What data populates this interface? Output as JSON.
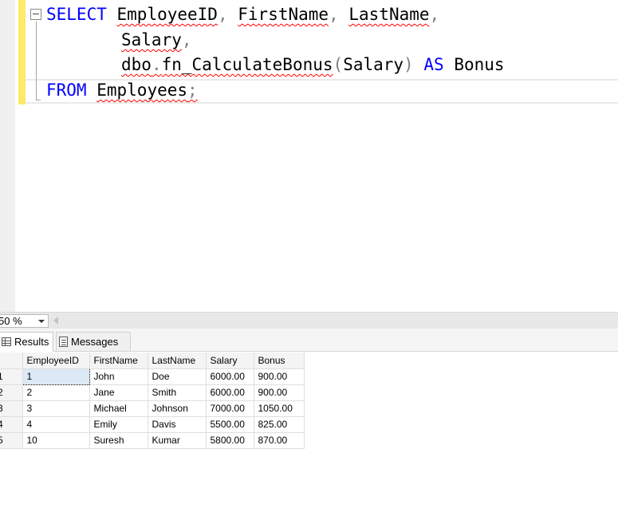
{
  "editor": {
    "line1": {
      "select": "SELECT",
      "employee_id": "EmployeeID",
      "c1": ",",
      "first_name": "FirstName",
      "c2": ",",
      "last_name": "LastName",
      "c3": ","
    },
    "line2": {
      "salary": "Salary",
      "c1": ","
    },
    "line3": {
      "func": "dbo",
      "dot": ".",
      "func_name": "fn_CalculateBonus",
      "lparen": "(",
      "arg": "Salary",
      "rparen": ")",
      "as": "AS",
      "alias": "Bonus"
    },
    "line4": {
      "from": "FROM",
      "table": "Employees",
      "semi": ";"
    }
  },
  "zoom": {
    "value": "50 %"
  },
  "tabs": {
    "results": "Results",
    "messages": "Messages"
  },
  "grid": {
    "columns": [
      "EmployeeID",
      "FirstName",
      "LastName",
      "Salary",
      "Bonus"
    ],
    "rows": [
      {
        "num": "1",
        "cells": [
          "1",
          "John",
          "Doe",
          "6000.00",
          "900.00"
        ]
      },
      {
        "num": "2",
        "cells": [
          "2",
          "Jane",
          "Smith",
          "6000.00",
          "900.00"
        ]
      },
      {
        "num": "3",
        "cells": [
          "3",
          "Michael",
          "Johnson",
          "7000.00",
          "1050.00"
        ]
      },
      {
        "num": "4",
        "cells": [
          "4",
          "Emily",
          "Davis",
          "5500.00",
          "825.00"
        ]
      },
      {
        "num": "5",
        "cells": [
          "10",
          "Suresh",
          "Kumar",
          "5800.00",
          "870.00"
        ]
      }
    ]
  },
  "colors": {
    "keyword": "#0000ff",
    "operator": "#808080",
    "squiggle": "#ff0000",
    "change_margin": "#fde96a"
  }
}
